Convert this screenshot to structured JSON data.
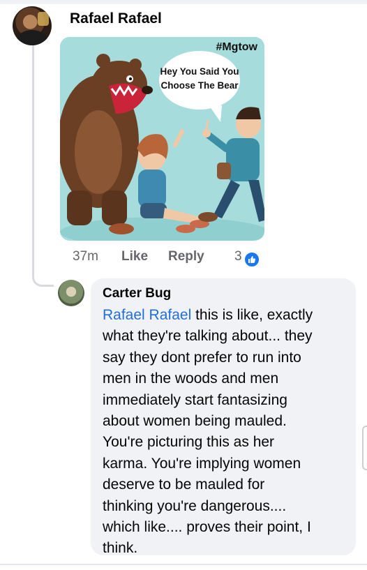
{
  "post": {
    "author": "Rafael Rafael",
    "meme": {
      "hashtag": "#Mgtow",
      "speech": [
        "Hey You Said You",
        "Choose The Bear"
      ]
    },
    "actions": {
      "time": "37m",
      "like": "Like",
      "reply": "Reply",
      "reaction_count": "3",
      "reaction_icon": "like-thumb-icon"
    }
  },
  "reply": {
    "author": "Carter Bug",
    "mention": "Rafael Rafael",
    "lines": [
      " this is like, exactly",
      "what they're talking about... they",
      "say they dont prefer to run into",
      "men in the woods and men",
      "immediately start fantasizing",
      "about women being mauled.",
      "You're picturing this as her",
      "karma. You're implying women",
      "deserve to be mauled for",
      "thinking you're dangerous....",
      "which like.... proves their point, I",
      "think."
    ]
  },
  "colors": {
    "mention": "#216fdb",
    "like_blue": "#1877f2",
    "bubble_bg": "#f0f2f5",
    "meta_gray": "#65676b"
  }
}
